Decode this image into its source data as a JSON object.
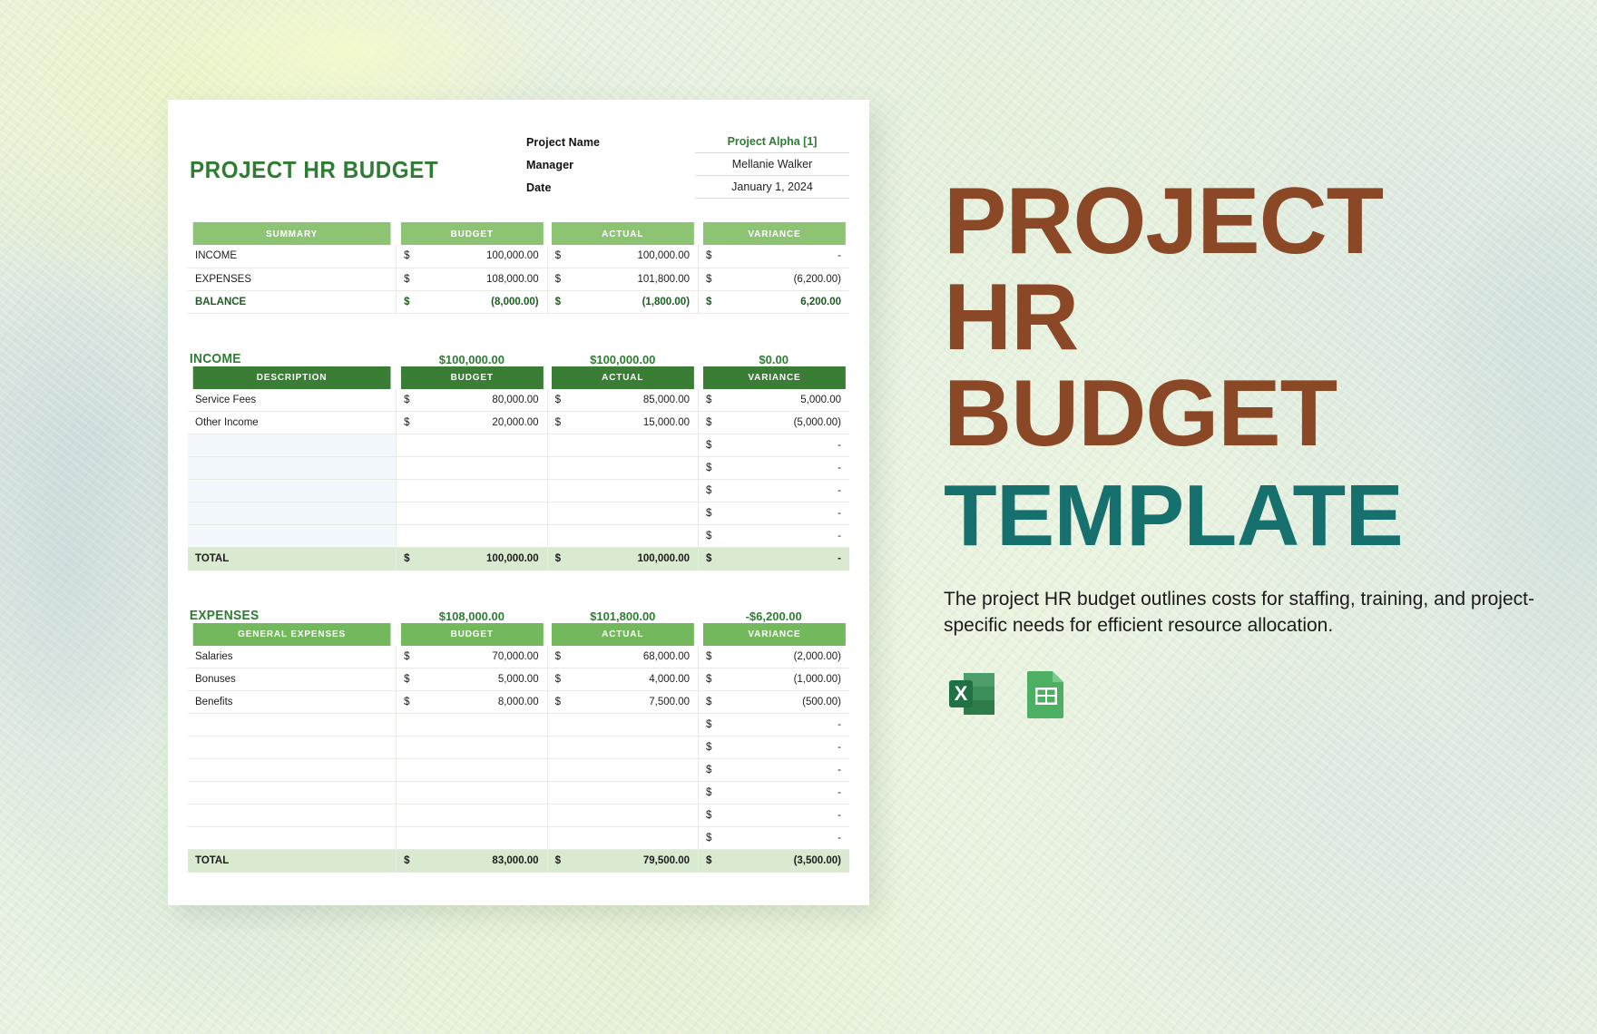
{
  "document": {
    "title": "PROJECT HR BUDGET",
    "meta": [
      {
        "label": "Project Name",
        "value": "Project Alpha",
        "ref": "[1]",
        "accent": true
      },
      {
        "label": "Manager",
        "value": "Mellanie Walker",
        "accent": false
      },
      {
        "label": "Date",
        "value": "January 1, 2024",
        "accent": false
      }
    ],
    "summary": {
      "headers": [
        "SUMMARY",
        "BUDGET",
        "ACTUAL",
        "VARIANCE"
      ],
      "rows": [
        {
          "label": "INCOME",
          "budget": "100,000.00",
          "actual": "100,000.00",
          "variance": "-"
        },
        {
          "label": "EXPENSES",
          "budget": "108,000.00",
          "actual": "101,800.00",
          "variance": "(6,200.00)"
        },
        {
          "label": "BALANCE",
          "budget": "(8,000.00)",
          "actual": "(1,800.00)",
          "variance": "6,200.00"
        }
      ],
      "currency_symbol": "$"
    },
    "income": {
      "section_label": "INCOME",
      "section_budget": "$100,000.00",
      "section_actual": "$100,000.00",
      "section_variance": "$0.00",
      "headers": [
        "DESCRIPTION",
        "BUDGET",
        "ACTUAL",
        "VARIANCE"
      ],
      "rows": [
        {
          "desc": "Service Fees",
          "budget": "80,000.00",
          "actual": "85,000.00",
          "variance": "5,000.00"
        },
        {
          "desc": "Other Income",
          "budget": "20,000.00",
          "actual": "15,000.00",
          "variance": "(5,000.00)"
        },
        {
          "desc": "",
          "budget": "",
          "actual": "",
          "variance": "-"
        },
        {
          "desc": "",
          "budget": "",
          "actual": "",
          "variance": "-"
        },
        {
          "desc": "",
          "budget": "",
          "actual": "",
          "variance": "-"
        },
        {
          "desc": "",
          "budget": "",
          "actual": "",
          "variance": "-"
        },
        {
          "desc": "",
          "budget": "",
          "actual": "",
          "variance": "-"
        }
      ],
      "total": {
        "label": "TOTAL",
        "budget": "100,000.00",
        "actual": "100,000.00",
        "variance": "-"
      }
    },
    "expenses": {
      "section_label": "EXPENSES",
      "section_budget": "$108,000.00",
      "section_actual": "$101,800.00",
      "section_variance": "-$6,200.00",
      "headers": [
        "GENERAL EXPENSES",
        "BUDGET",
        "ACTUAL",
        "VARIANCE"
      ],
      "rows": [
        {
          "desc": "Salaries",
          "budget": "70,000.00",
          "actual": "68,000.00",
          "variance": "(2,000.00)"
        },
        {
          "desc": "Bonuses",
          "budget": "5,000.00",
          "actual": "4,000.00",
          "variance": "(1,000.00)"
        },
        {
          "desc": "Benefits",
          "budget": "8,000.00",
          "actual": "7,500.00",
          "variance": "(500.00)"
        },
        {
          "desc": "",
          "budget": "",
          "actual": "",
          "variance": "-"
        },
        {
          "desc": "",
          "budget": "",
          "actual": "",
          "variance": "-"
        },
        {
          "desc": "",
          "budget": "",
          "actual": "",
          "variance": "-"
        },
        {
          "desc": "",
          "budget": "",
          "actual": "",
          "variance": "-"
        },
        {
          "desc": "",
          "budget": "",
          "actual": "",
          "variance": "-"
        },
        {
          "desc": "",
          "budget": "",
          "actual": "",
          "variance": "-"
        }
      ],
      "total": {
        "label": "TOTAL",
        "budget": "83,000.00",
        "actual": "79,500.00",
        "variance": "(3,500.00)"
      }
    }
  },
  "promo": {
    "line1": "PROJECT",
    "line2": "HR",
    "line3": "BUDGET",
    "template_word": "TEMPLATE",
    "description": "The project HR budget outlines costs for staffing, training, and project-specific needs for efficient resource allocation.",
    "formats": [
      {
        "name": "excel-icon",
        "label": "X"
      },
      {
        "name": "google-sheets-icon",
        "label": ""
      }
    ]
  },
  "colors": {
    "brand_green": "#2e7d32",
    "header_light_green": "#8cc474",
    "header_dark_green": "#3a7d34",
    "header_mid_green": "#73b85c",
    "total_row_green": "#d9ead0",
    "promo_brown": "#8b4826",
    "promo_teal": "#16716e",
    "canvas": "#e6f0d9"
  }
}
